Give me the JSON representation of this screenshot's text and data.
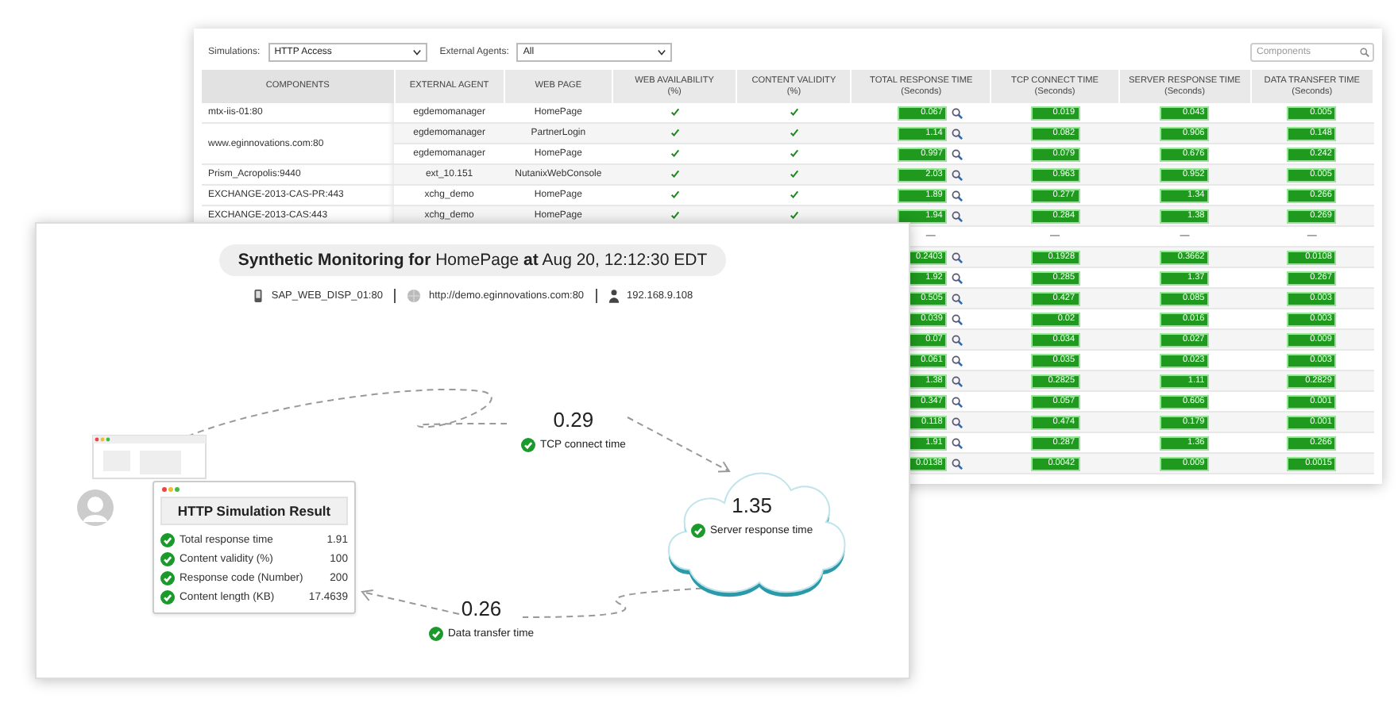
{
  "filters": {
    "simulations_label": "Simulations:",
    "simulations_value": "HTTP Access",
    "agents_label": "External Agents:",
    "agents_value": "All",
    "search": {
      "placeholder": "Components"
    }
  },
  "table": {
    "columns": [
      {
        "title": "COMPONENTS"
      },
      {
        "title": "EXTERNAL AGENT"
      },
      {
        "title": "WEB PAGE"
      },
      {
        "title": "WEB AVAILABILITY",
        "unit": "(%)"
      },
      {
        "title": "CONTENT VALIDITY",
        "unit": "(%)"
      },
      {
        "title": "TOTAL RESPONSE TIME",
        "unit": "(Seconds)"
      },
      {
        "title": "TCP CONNECT TIME",
        "unit": "(Seconds)"
      },
      {
        "title": "SERVER RESPONSE TIME",
        "unit": "(Seconds)"
      },
      {
        "title": "DATA TRANSFER TIME",
        "unit": "(Seconds)"
      }
    ],
    "groups": [
      {
        "component": "mtx-iis-01:80",
        "rows": [
          {
            "kind": "bars",
            "agent": "egdemomanager",
            "page": "HomePage",
            "available": true,
            "valid": true,
            "total": "0.067",
            "tcp": "0.019",
            "server": "0.043",
            "data": "0.005"
          }
        ]
      },
      {
        "component": "www.eginnovations.com:80",
        "rows": [
          {
            "kind": "bars",
            "agent": "egdemomanager",
            "page": "PartnerLogin",
            "available": true,
            "valid": true,
            "total": "1.14",
            "tcp": "0.082",
            "server": "0.906",
            "data": "0.148"
          },
          {
            "kind": "bars",
            "agent": "egdemomanager",
            "page": "HomePage",
            "available": true,
            "valid": true,
            "total": "0.997",
            "tcp": "0.079",
            "server": "0.676",
            "data": "0.242"
          }
        ]
      },
      {
        "component": "Prism_Acropolis:9440",
        "rows": [
          {
            "kind": "bars",
            "agent": "ext_10.151",
            "page": "NutanixWebConsole",
            "available": true,
            "valid": true,
            "total": "2.03",
            "tcp": "0.963",
            "server": "0.952",
            "data": "0.005"
          }
        ]
      },
      {
        "component": "EXCHANGE-2013-CAS-PR:443",
        "rows": [
          {
            "kind": "bars",
            "agent": "xchg_demo",
            "page": "HomePage",
            "available": true,
            "valid": true,
            "total": "1.89",
            "tcp": "0.277",
            "server": "1.34",
            "data": "0.266"
          }
        ]
      },
      {
        "component": "EXCHANGE-2013-CAS:443",
        "rows": [
          {
            "kind": "bars",
            "agent": "xchg_demo",
            "page": "HomePage",
            "available": true,
            "valid": true,
            "total": "1.94",
            "tcp": "0.284",
            "server": "1.38",
            "data": "0.269"
          }
        ]
      },
      {
        "rows": [
          {
            "kind": "dash",
            "total": "—",
            "tcp": "—",
            "server": "—",
            "data": "—"
          },
          {
            "kind": "bars",
            "total": "0.2403",
            "tcp": "0.1928",
            "server": "0.3662",
            "data": "0.0108"
          },
          {
            "kind": "bars",
            "total": "1.92",
            "tcp": "0.285",
            "server": "1.37",
            "data": "0.267"
          },
          {
            "kind": "bars",
            "total": "0.505",
            "tcp": "0.427",
            "server": "0.085",
            "data": "0.003"
          },
          {
            "kind": "bars",
            "total": "0.039",
            "tcp": "0.02",
            "server": "0.016",
            "data": "0.003"
          },
          {
            "kind": "bars",
            "total": "0.07",
            "tcp": "0.034",
            "server": "0.027",
            "data": "0.009"
          },
          {
            "kind": "bars",
            "total": "0.061",
            "tcp": "0.035",
            "server": "0.023",
            "data": "0.003"
          },
          {
            "kind": "bars",
            "total": "1.38",
            "tcp": "0.2825",
            "server": "1.11",
            "data": "0.2829"
          },
          {
            "kind": "bars",
            "total": "0.347",
            "tcp": "0.057",
            "server": "0.606",
            "data": "0.001"
          },
          {
            "kind": "bars",
            "total": "0.118",
            "tcp": "0.474",
            "server": "0.179",
            "data": "0.001"
          },
          {
            "kind": "bars",
            "total": "1.91",
            "tcp": "0.287",
            "server": "1.36",
            "data": "0.266"
          },
          {
            "kind": "bars",
            "total": "0.0138",
            "tcp": "0.0042",
            "server": "0.009",
            "data": "0.0015"
          }
        ]
      }
    ]
  },
  "monitor": {
    "title": "**Synthetic Monitoring for** HomePage **at** Aug 20, 12:12:30 EDT",
    "server": "SAP_WEB_DISP_01:80",
    "url": "http://demo.eginnovations.com:80",
    "ip": "192.168.9.108",
    "result": {
      "title": "HTTP Simulation Result",
      "metrics": [
        {
          "label": "Total response time",
          "value": "1.91",
          "ok": true
        },
        {
          "label": "Content validity (%)",
          "value": "100",
          "ok": true
        },
        {
          "label": "Response code (Number)",
          "value": "200",
          "ok": true
        },
        {
          "label": "Content length (KB)",
          "value": "17.4639",
          "ok": true
        }
      ]
    },
    "tcp": {
      "value": "0.29",
      "label": "TCP connect time",
      "ok": true
    },
    "server_response": {
      "value": "1.35",
      "label": "Server response time",
      "ok": true
    },
    "data_transfer": {
      "value": "0.26",
      "label": "Data transfer time",
      "ok": true
    }
  }
}
